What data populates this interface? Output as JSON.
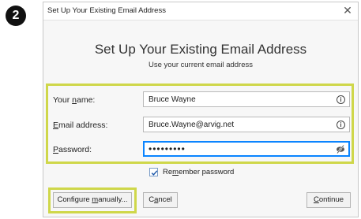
{
  "step_badge": "2",
  "dialog": {
    "title": "Set Up Your Existing Email Address",
    "close_glyph": "✕"
  },
  "header": {
    "heading": "Set Up Your Existing Email Address",
    "subheading": "Use your current email address"
  },
  "form": {
    "name": {
      "label_pre": "Your ",
      "label_key": "n",
      "label_post": "ame:",
      "value": "Bruce Wayne"
    },
    "email": {
      "label_pre": "",
      "label_key": "E",
      "label_post": "mail address:",
      "value": "Bruce.Wayne@arvig.net"
    },
    "password": {
      "label_pre": "",
      "label_key": "P",
      "label_post": "assword:",
      "value": "secretpw!"
    },
    "remember": {
      "label_pre": "Re",
      "label_key": "m",
      "label_post": "ember password",
      "checked": true
    }
  },
  "buttons": {
    "configure": {
      "pre": "Configure ",
      "key": "m",
      "post": "anually..."
    },
    "cancel": {
      "pre": "C",
      "key": "a",
      "post": "ncel"
    },
    "continue": {
      "pre": "",
      "key": "C",
      "post": "ontinue"
    }
  },
  "colors": {
    "highlight": "#cfd74a",
    "focus": "#0a84ff"
  },
  "icons": {
    "info": "info-icon",
    "eye": "eye-slash-icon",
    "check": "checkmark-icon",
    "close": "close-icon"
  }
}
